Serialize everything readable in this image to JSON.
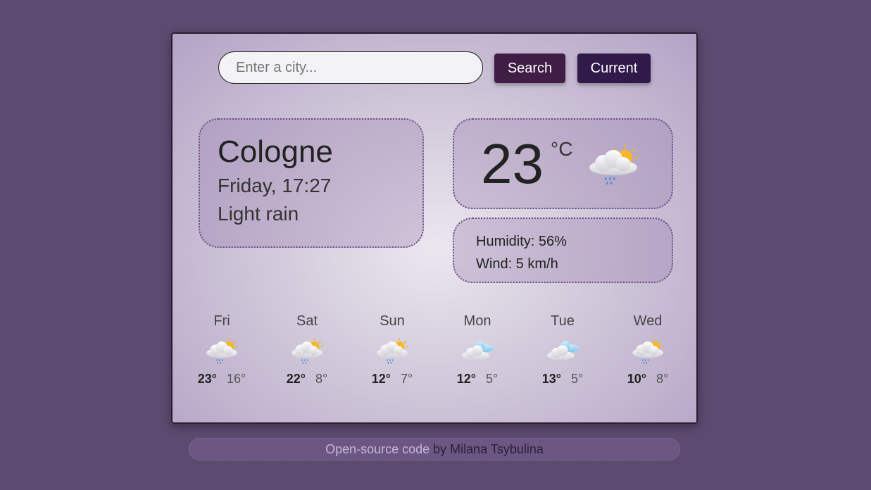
{
  "search": {
    "placeholder": "Enter a city...",
    "value": "",
    "search_label": "Search",
    "current_label": "Current"
  },
  "current": {
    "city": "Cologne",
    "datetime": "Friday, 17:27",
    "description": "Light rain",
    "temperature": "23",
    "unit": "°C",
    "icon": "rain-sun-cloud-icon",
    "humidity": "Humidity: 56%",
    "wind": "Wind: 5 km/h"
  },
  "forecast": [
    {
      "day": "Fri",
      "max": "23°",
      "min": "16°",
      "icon": "rain-sun-cloud-icon"
    },
    {
      "day": "Sat",
      "max": "22°",
      "min": "8°",
      "icon": "rain-sun-cloud-icon"
    },
    {
      "day": "Sun",
      "max": "12°",
      "min": "7°",
      "icon": "rain-sun-cloud-icon"
    },
    {
      "day": "Mon",
      "max": "12°",
      "min": "5°",
      "icon": "clouds-icon"
    },
    {
      "day": "Tue",
      "max": "13°",
      "min": "5°",
      "icon": "clouds-icon"
    },
    {
      "day": "Wed",
      "max": "10°",
      "min": "8°",
      "icon": "rain-sun-cloud-icon"
    }
  ],
  "footer": {
    "link_text": "Open-source code",
    "author_text": " by Milana Tsybulina"
  },
  "colors": {
    "background": "#5d4a70",
    "search_button": "#3f1d45",
    "current_button": "#2f1a4a"
  }
}
